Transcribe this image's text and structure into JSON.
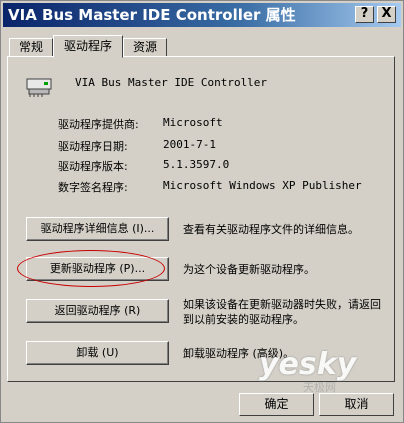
{
  "window": {
    "title": "VIA Bus Master IDE Controller 属性",
    "help_btn": "?",
    "close_btn": "X"
  },
  "tabs": [
    {
      "label": "常规",
      "active": false
    },
    {
      "label": "驱动程序",
      "active": true
    },
    {
      "label": "资源",
      "active": false
    }
  ],
  "device": {
    "name": "VIA Bus Master IDE Controller",
    "icon": "ide-controller-icon"
  },
  "properties": [
    {
      "label": "驱动程序提供商:",
      "value": "Microsoft"
    },
    {
      "label": "驱动程序日期:",
      "value": "2001-7-1"
    },
    {
      "label": "驱动程序版本:",
      "value": "5.1.3597.0"
    },
    {
      "label": "数字签名程序:",
      "value": "Microsoft Windows XP Publisher"
    }
  ],
  "actions": [
    {
      "button": "驱动程序详细信息 (I)...",
      "desc": "查看有关驱动程序文件的详细信息。"
    },
    {
      "button": "更新驱动程序 (P)...",
      "desc": "为这个设备更新驱动程序。"
    },
    {
      "button": "返回驱动程序 (R)",
      "desc": "如果该设备在更新驱动器时失败，请返回到以前安装的驱动程序。"
    },
    {
      "button": "卸载 (U)",
      "desc": "卸载驱动程序 (高级)。"
    }
  ],
  "footer": {
    "ok": "确定",
    "cancel": "取消"
  },
  "watermark": {
    "brand": "yesky",
    "sub": "天极网"
  },
  "colors": {
    "highlight": "#c80000",
    "title_bar": "#0a246a"
  }
}
